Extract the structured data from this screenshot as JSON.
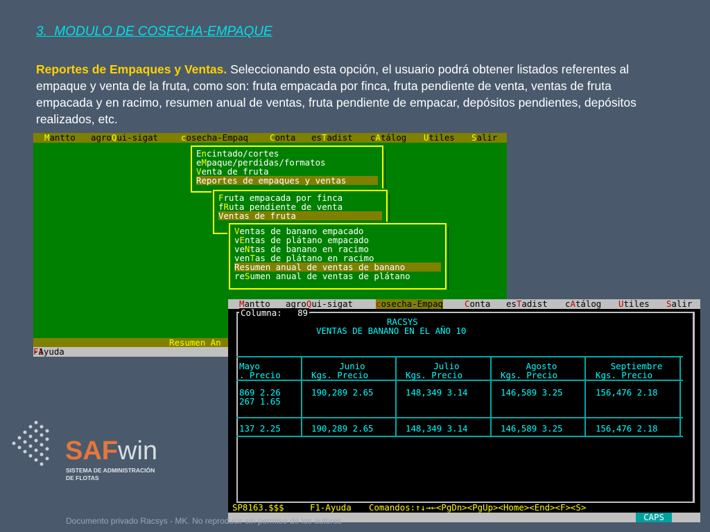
{
  "heading": {
    "number": "3.",
    "title": "MODULO DE COSECHA-EMPAQUE"
  },
  "intro": {
    "lead": "Reportes de Empaques y Ventas.",
    "text": " Seleccionando esta opción, el usuario podrá obtener listados referentes al empaque y venta de la fruta, como son: fruta empacada por finca, fruta pendiente de venta, ventas de fruta empacada y en racimo, resumen anual de ventas, fruta pendiente de empacar, depósitos pendientes, depósitos realizados, etc."
  },
  "screen1": {
    "menubar": [
      {
        "pre": "",
        "hot": "M",
        "post": "antto"
      },
      {
        "pre": "agro",
        "hot": "Q",
        "post": "ui-sigat"
      },
      {
        "pre": "",
        "hot": "c",
        "post": "osecha-Empaq"
      },
      {
        "pre": "",
        "hot": "C",
        "post": "onta"
      },
      {
        "pre": "es",
        "hot": "T",
        "post": "adist"
      },
      {
        "pre": "c",
        "hot": "A",
        "post": "tálog"
      },
      {
        "pre": "",
        "hot": "U",
        "post": "tiles"
      },
      {
        "pre": "",
        "hot": "S",
        "post": "alir"
      }
    ],
    "menu1": [
      {
        "pre": "E",
        "hot": "n",
        "post": "cintado/cortes"
      },
      {
        "pre": "e",
        "hot": "M",
        "post": "paque/perdidas/formatos"
      },
      {
        "pre": "",
        "hot": "V",
        "post": "enta de fruta"
      },
      {
        "pre": "",
        "hot": "",
        "post": "Reportes de empaques y ventas"
      }
    ],
    "menu2": [
      {
        "pre": "",
        "hot": "F",
        "post": "ruta empacada por finca"
      },
      {
        "pre": "f",
        "hot": "R",
        "post": "uta pendiente de venta"
      },
      {
        "pre": "",
        "hot": "",
        "post": "Ventas de fruta"
      }
    ],
    "menu3": [
      {
        "pre": "",
        "hot": "V",
        "post": "entas de banano empacado"
      },
      {
        "pre": "v",
        "hot": "E",
        "post": "ntas de plátano empacado"
      },
      {
        "pre": "ve",
        "hot": "N",
        "post": "tas de banano en racimo"
      },
      {
        "pre": "ven",
        "hot": "T",
        "post": "as de plátano en racimo"
      },
      {
        "pre": "",
        "hot": "",
        "post": "Resumen anual de ventas de banano"
      },
      {
        "pre": "re",
        "hot": "S",
        "post": "umen anual de ventas de plátano"
      }
    ],
    "status": "Resumen An",
    "help_key": "F1",
    "help_text": "-Ayuda"
  },
  "screen2": {
    "column_label": "Columna:",
    "column_value": "89",
    "company": "RACSYS",
    "report_title": "VENTAS DE BANANO EN EL AÑO 10",
    "months": [
      "Mayo",
      "Junio",
      "Julio",
      "Agosto",
      "Septiembre"
    ],
    "subheader_first": ".   Precio",
    "subheader": "Kgs.   Precio",
    "rows": [
      [
        "869    2.26",
        "190,289    2.65",
        "148,349    3.14",
        "146,589    3.25",
        "156,476    2.18"
      ],
      [
        "267    1.65",
        "",
        "",
        "",
        ""
      ]
    ],
    "totals": [
      "137    2.25",
      "190,289    2.65",
      "148,349    3.14",
      "146,589    3.25",
      "156,476    2.18"
    ],
    "status_prog": "SP8163.$$$",
    "status_help": "F1-Ayuda",
    "status_cmds": "Comandos:↑↓→←<PgDn><PgUp><Home><End><F><S>",
    "caps": "CAPS"
  },
  "logo": {
    "brand_a": "SAF",
    "brand_b": "win",
    "sub1": "SISTEMA DE ADMINISTRACIÓN",
    "sub2": "DE FLOTAS"
  },
  "footer": "Documento privado Racsys - MK. No reproducir sin permiso de los autores"
}
